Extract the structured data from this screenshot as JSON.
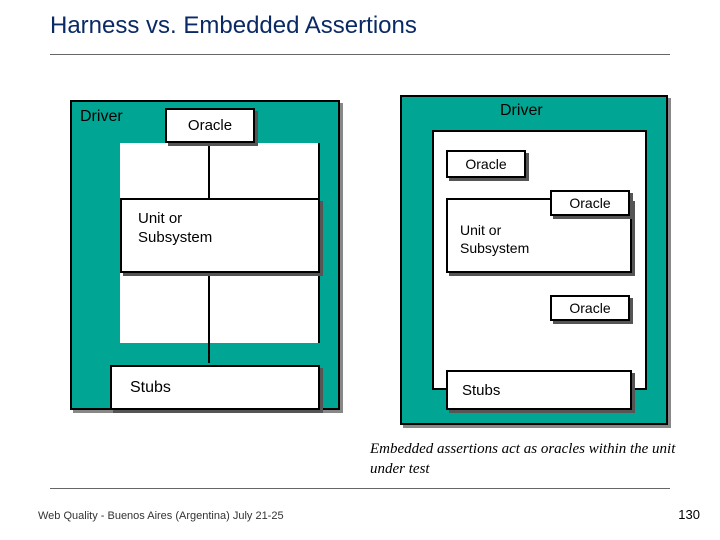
{
  "title": "Harness vs. Embedded Assertions",
  "left": {
    "driver": "Driver",
    "oracle": "Oracle",
    "unit": "Unit or\nSubsystem",
    "stubs": "Stubs"
  },
  "right": {
    "driver": "Driver",
    "oracle_top": "Oracle",
    "oracle_inner": "Oracle",
    "unit": "Unit or\nSubsystem",
    "oracle_bot": "Oracle",
    "stubs": "Stubs"
  },
  "caption": "Embedded assertions  act as oracles within the unit under test",
  "footer_left": "Web Quality - Buenos Aires (Argentina) July 21-25",
  "footer_right": "130"
}
